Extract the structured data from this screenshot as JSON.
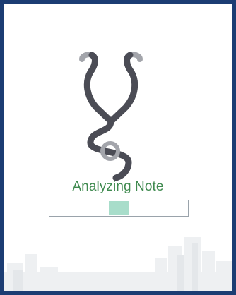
{
  "status": {
    "label": "Analyzing Note"
  },
  "progress": {
    "indeterminate": true,
    "segment_start": 0.43,
    "segment_end": 0.58
  },
  "colors": {
    "frame": "#1c3d73",
    "label": "#3f8a4f",
    "progress_fill": "#a8ddca",
    "icon": "#4b4c55",
    "icon_tips": "#a3a5ab"
  },
  "icons": {
    "main": "stethoscope-icon"
  }
}
